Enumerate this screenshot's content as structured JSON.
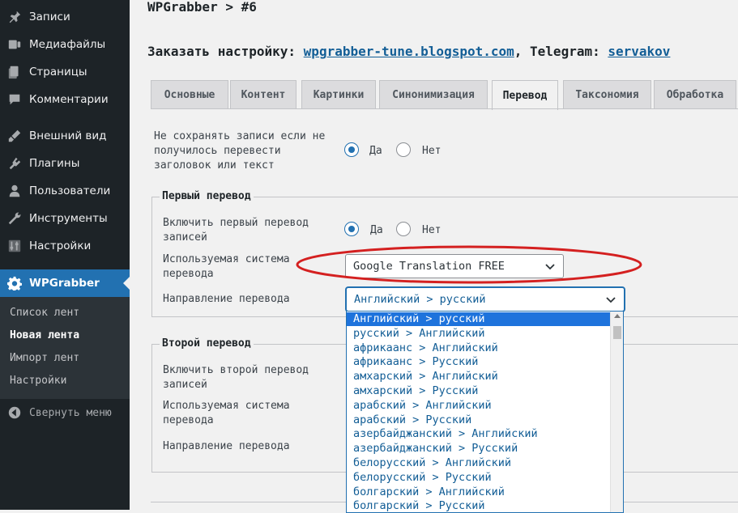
{
  "sidebar": {
    "items": [
      {
        "label": "Записи",
        "icon": "pin-icon"
      },
      {
        "label": "Медиафайлы",
        "icon": "media-icon"
      },
      {
        "label": "Страницы",
        "icon": "pages-icon"
      },
      {
        "label": "Комментарии",
        "icon": "comments-icon"
      },
      {
        "label": "Внешний вид",
        "icon": "appearance-icon"
      },
      {
        "label": "Плагины",
        "icon": "plugins-icon"
      },
      {
        "label": "Пользователи",
        "icon": "users-icon"
      },
      {
        "label": "Инструменты",
        "icon": "tools-icon"
      },
      {
        "label": "Настройки",
        "icon": "settings-icon"
      },
      {
        "label": "WPGrabber",
        "icon": "gear-icon"
      }
    ],
    "submenu": [
      "Список лент",
      "Новая лента",
      "Импорт лент",
      "Настройки"
    ],
    "collapse_label": "Свернуть меню"
  },
  "header": {
    "title": "WPGrabber > #6",
    "order_prefix": "Заказать настройку:",
    "order_link": "wpgrabber-tune.blogspot.com",
    "telegram_prefix": ", Telegram:",
    "telegram_link": "servakov"
  },
  "tabs": [
    "Основные",
    "Контент",
    "Картинки",
    "Синонимизация",
    "Перевод",
    "Таксономия",
    "Обработка"
  ],
  "translate": {
    "no_save_label": "Не сохранять записи если не получилось перевести заголовок или текст",
    "yes": "Да",
    "no": "Нет",
    "first": {
      "legend": "Первый перевод",
      "enable_label": "Включить первый перевод записей",
      "system_label": "Используемая система перевода",
      "system_value": "Google Translation FREE",
      "direction_label": "Направление перевода",
      "direction_value": "Английский > русский"
    },
    "second": {
      "legend": "Второй перевод",
      "enable_label": "Включить второй перевод записей",
      "system_label": "Используемая система перевода",
      "direction_label": "Направление перевода"
    },
    "direction_options": [
      "Английский > русский",
      "русский > Английский",
      "африкаанс > Английский",
      "африкаанс > Русский",
      "амхарский > Английский",
      "амхарский > Русский",
      "арабский > Английский",
      "арабский > Русский",
      "азербайджанский > Английский",
      "азербайджанский > Русский",
      "белорусский > Английский",
      "белорусский > Русский",
      "болгарский > Английский",
      "болгарский > Русский"
    ]
  },
  "colors": {
    "accent": "#2271b1",
    "sidebar": "#1d2327",
    "highlight_ellipse": "#d42020"
  }
}
